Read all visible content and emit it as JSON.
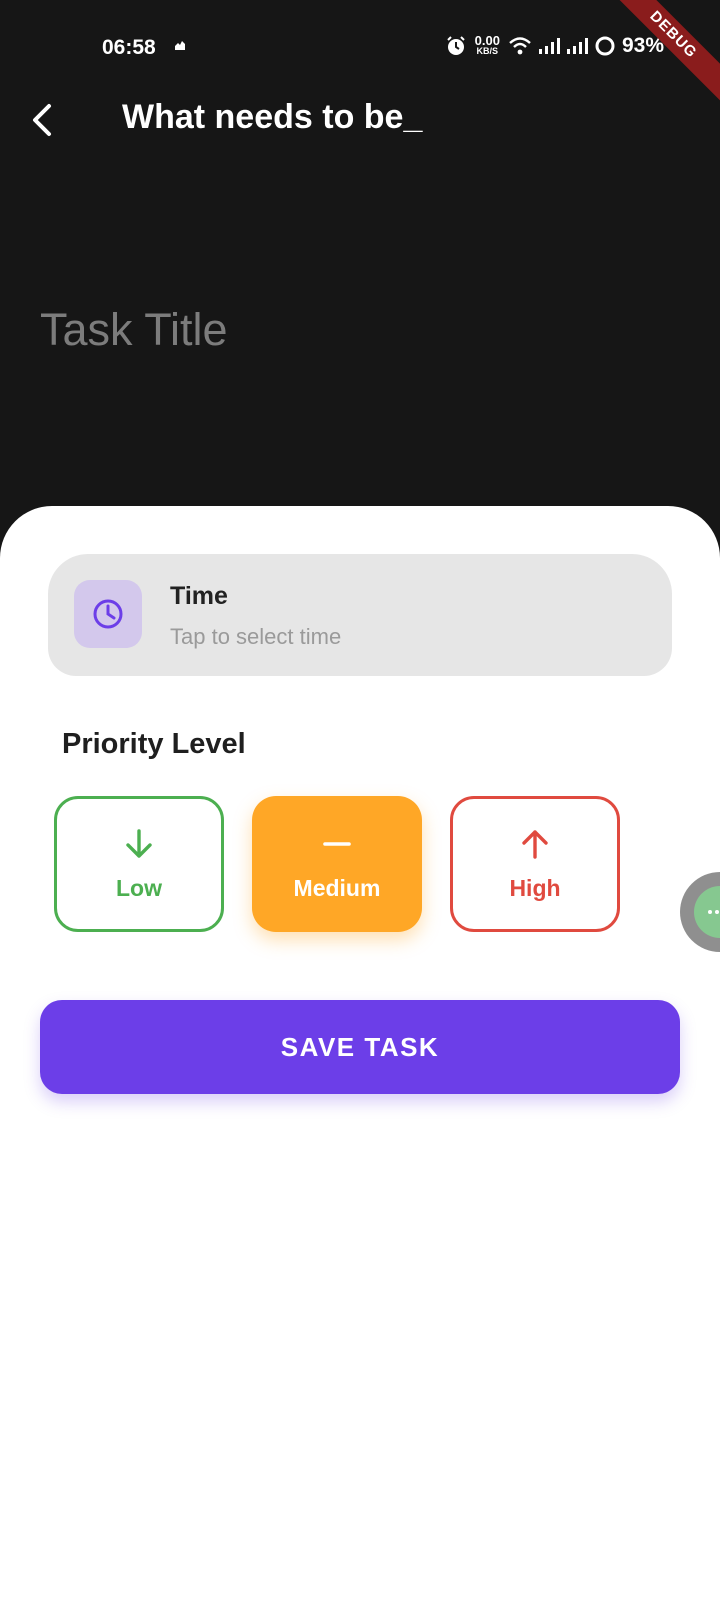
{
  "status_bar": {
    "time": "06:58",
    "net_speed_value": "0.00",
    "net_speed_unit": "KB/S",
    "battery": "93%"
  },
  "debug_banner": "DEBUG",
  "app_bar": {
    "title": "What needs to be_"
  },
  "task_title": {
    "placeholder": "Task Title",
    "value": ""
  },
  "time_card": {
    "label": "Time",
    "hint": "Tap to select time"
  },
  "priority": {
    "heading": "Priority Level",
    "options": [
      {
        "label": "Low",
        "color": "#4caf50",
        "selected": false
      },
      {
        "label": "Medium",
        "color": "#ffa726",
        "selected": true
      },
      {
        "label": "High",
        "color": "#e04a3f",
        "selected": false
      }
    ]
  },
  "save_button": {
    "label": "SAVE TASK",
    "color": "#6c3ee8"
  }
}
